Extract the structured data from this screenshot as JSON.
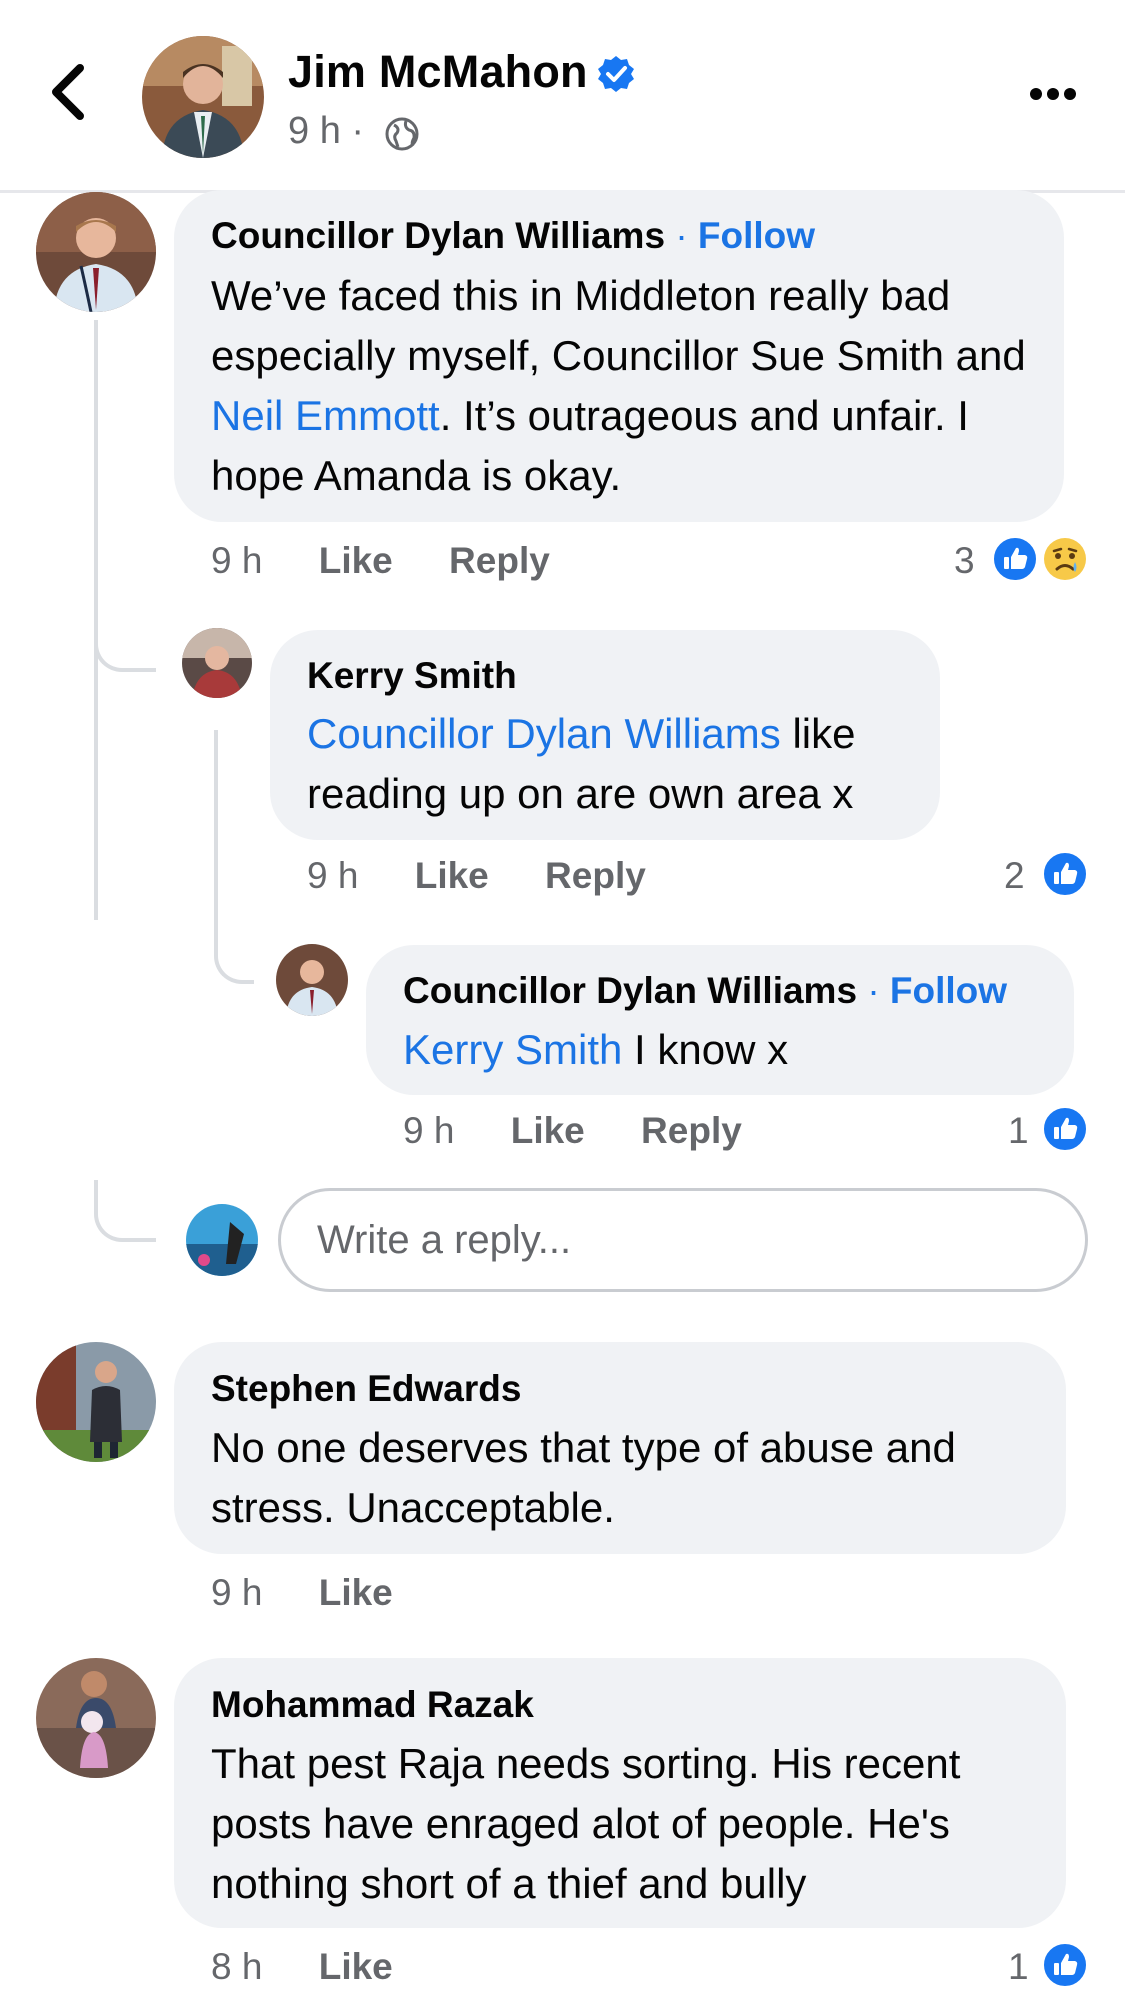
{
  "header": {
    "author": "Jim McMahon",
    "time": "9 h",
    "separator": "·"
  },
  "comments": [
    {
      "name": "Councillor Dylan Williams",
      "dot": "·",
      "follow": "Follow",
      "text_1": "We’ve faced this in Middleton really bad especially myself, Councillor Sue Smith and ",
      "mention": "Neil Emmott",
      "text_2": ". It’s outrageous and unfair. I hope Amanda is okay.",
      "time": "9 h",
      "like": "Like",
      "reply": "Reply",
      "reaction_count": "3"
    },
    {
      "name": "Kerry Smith",
      "mention": "Councillor Dylan Williams",
      "text": " like reading up on are own area x",
      "time": "9 h",
      "like": "Like",
      "reply": "Reply",
      "reaction_count": "2"
    },
    {
      "name": "Councillor Dylan Williams",
      "dot": "·",
      "follow": "Follow",
      "mention": "Kerry Smith",
      "text": " I know x",
      "time": "9 h",
      "like": "Like",
      "reply": "Reply",
      "reaction_count": "1"
    },
    {
      "name": "Stephen Edwards",
      "text": "No one deserves that type of abuse and stress.  Unacceptable.",
      "time": "9 h",
      "like": "Like"
    },
    {
      "name": "Mohammad Razak",
      "text": "That pest Raja needs sorting. His recent posts have enraged alot of people. He's nothing short of a thief and bully",
      "time": "8 h",
      "like": "Like",
      "reaction_count": "1"
    }
  ],
  "reply_box": {
    "placeholder": "Write a reply..."
  },
  "icons": {
    "back": "chevron-left-icon",
    "verified": "verified-badge-icon",
    "audience": "globe-icon",
    "more": "more-options-icon",
    "like_reaction": "like-reaction-icon",
    "sad_reaction": "sad-reaction-icon"
  },
  "colors": {
    "accent": "#1b74e4",
    "like_blue": "#1877f2",
    "bubble": "#f0f2f5",
    "secondary_text": "#65676b"
  }
}
